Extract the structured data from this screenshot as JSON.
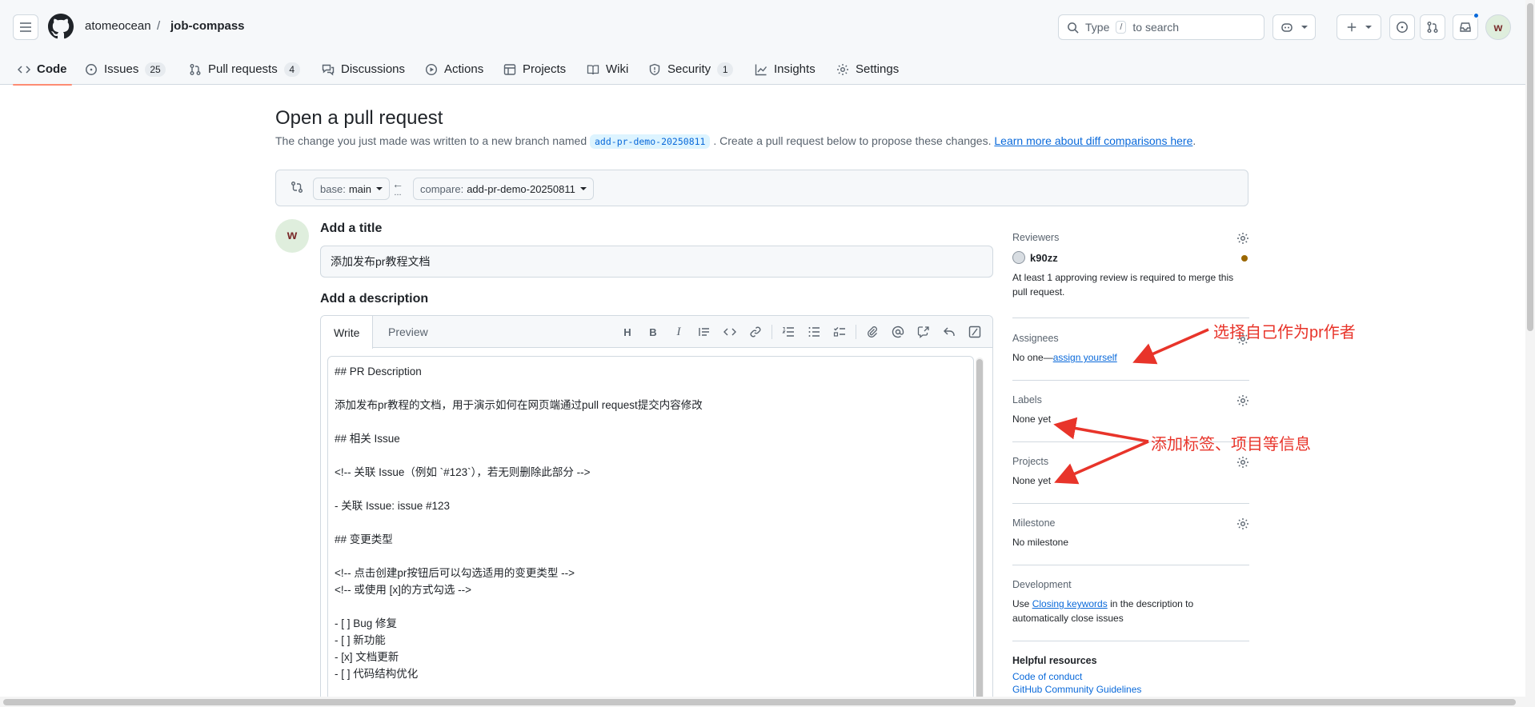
{
  "header": {
    "owner": "atomeocean",
    "separator": "/",
    "repo": "job-compass",
    "search_prefix": "Type",
    "search_key": "/",
    "search_suffix": "to search",
    "avatar_initial": "w"
  },
  "nav": {
    "tabs": [
      {
        "label": "Code"
      },
      {
        "label": "Issues",
        "count": "25"
      },
      {
        "label": "Pull requests",
        "count": "4"
      },
      {
        "label": "Discussions"
      },
      {
        "label": "Actions"
      },
      {
        "label": "Projects"
      },
      {
        "label": "Wiki"
      },
      {
        "label": "Security",
        "count": "1"
      },
      {
        "label": "Insights"
      },
      {
        "label": "Settings"
      }
    ]
  },
  "main": {
    "title": "Open a pull request",
    "subtitle_before": "The change you just made was written to a new branch named",
    "branch_name": "add-pr-demo-20250811",
    "subtitle_after": ". Create a pull request below to propose these changes.",
    "subtitle_link": "Learn more about diff comparisons here",
    "subtitle_end": ".",
    "base_prefix": "base:",
    "base_value": "main",
    "compare_prefix": "compare:",
    "compare_value": "add-pr-demo-20250811",
    "arrow_glyph": "←",
    "ellipsis": "...",
    "avatar_initial": "w",
    "add_title_label": "Add a title",
    "title_value": "添加发布pr教程文档",
    "add_desc_label": "Add a description",
    "tab_write": "Write",
    "tab_preview": "Preview",
    "toolbar_heading": "H",
    "toolbar_bold": "B",
    "toolbar_italic": "I",
    "description": "## PR Description\n\n添加发布pr教程的文档，用于演示如何在网页端通过pull request提交内容修改\n\n## 相关 Issue\n\n<!-- 关联 Issue（例如 `#123`），若无则删除此部分 -->\n\n- 关联 Issue: issue #123\n\n## 变更类型\n\n<!-- 点击创建pr按钮后可以勾选适用的变更类型 -->\n<!-- 或使用 [x]的方式勾选 -->\n\n- [ ] Bug 修复\n- [ ] 新功能\n- [x] 文档更新\n- [ ] 代码结构优化"
  },
  "sidebar": {
    "reviewers": {
      "title": "Reviewers",
      "user": "k90zz",
      "note": "At least 1 approving review is required to merge this pull request."
    },
    "assignees": {
      "title": "Assignees",
      "prefix": "No one—",
      "link": "assign yourself"
    },
    "labels": {
      "title": "Labels",
      "value": "None yet"
    },
    "projects": {
      "title": "Projects",
      "value": "None yet"
    },
    "milestone": {
      "title": "Milestone",
      "value": "No milestone"
    },
    "development": {
      "title": "Development",
      "prefix": "Use",
      "link": "Closing keywords",
      "suffix": "in the description to automatically close issues"
    },
    "help": {
      "title": "Helpful resources",
      "links": [
        "Code of conduct",
        "GitHub Community Guidelines"
      ]
    }
  },
  "annotations": {
    "assignee_note": "选择自己作为pr作者",
    "labels_note": "添加标签、项目等信息",
    "color": "#e8342a"
  }
}
